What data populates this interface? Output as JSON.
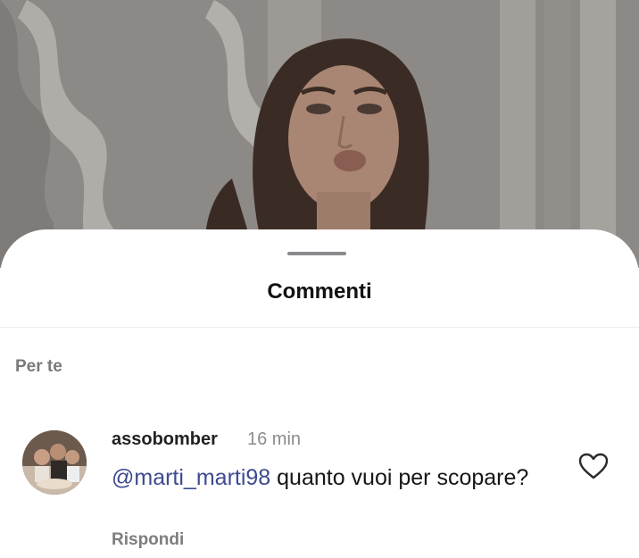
{
  "sheet": {
    "title": "Commenti",
    "section_label": "Per te"
  },
  "comments": [
    {
      "username": "assobomber",
      "time": "16 min",
      "mention": "@marti_marti98",
      "text": " quanto vuoi per scopare?",
      "reply_label": "Rispondi",
      "liked": false
    }
  ],
  "icons": {
    "like": "heart-outline-icon",
    "mention_prefix": "at-icon"
  },
  "colors": {
    "mention": "#3d4a8f",
    "secondary_text": "#8c8c8c"
  }
}
